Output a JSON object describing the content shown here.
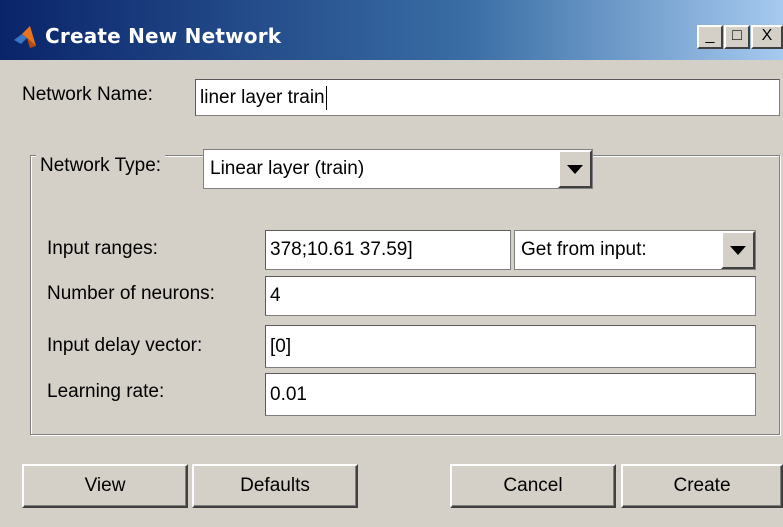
{
  "window": {
    "title": "Create New Network",
    "controls": {
      "minimize": "_",
      "maximize": "□",
      "close": "X"
    }
  },
  "network_name": {
    "label": "Network Name:",
    "value": "liner layer train"
  },
  "network_type": {
    "label": "Network Type:",
    "selected": "Linear layer (train)"
  },
  "params": {
    "input_ranges": {
      "label": "Input ranges:",
      "value": "378;10.61 37.59]",
      "source_selected": "Get from input:"
    },
    "neurons": {
      "label": "Number of neurons:",
      "value": "4"
    },
    "delay": {
      "label": "Input delay vector:",
      "value": "[0]"
    },
    "learning_rate": {
      "label": "Learning rate:",
      "value": "0.01"
    }
  },
  "buttons": {
    "view": "View",
    "defaults": "Defaults",
    "cancel": "Cancel",
    "create": "Create"
  },
  "icons": {
    "app": "matlab-logo-icon",
    "dropdown": "dropdown-arrow-icon"
  },
  "colors": {
    "titlebar_start": "#0a246a",
    "titlebar_end": "#a6caf0",
    "face": "#d4d0c8"
  }
}
